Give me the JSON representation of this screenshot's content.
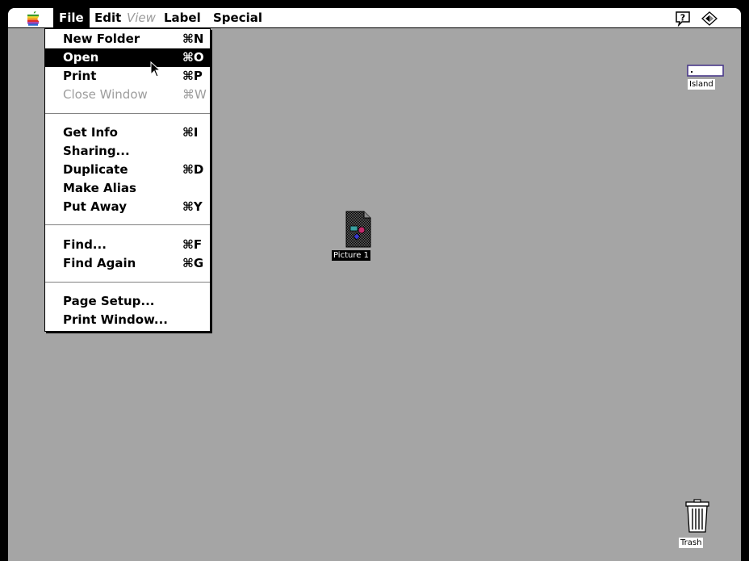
{
  "menubar": {
    "file": "File",
    "edit": "Edit",
    "view": "View",
    "label": "Label",
    "special": "Special",
    "apple_icon": "apple-icon",
    "help_icon": "balloon-help-icon",
    "app_icon": "finder-app-icon"
  },
  "file_menu": {
    "items": [
      {
        "label": "New Folder",
        "shortcut": "⌘N"
      },
      {
        "label": "Open",
        "shortcut": "⌘O",
        "selected": true
      },
      {
        "label": "Print",
        "shortcut": "⌘P"
      },
      {
        "label": "Close Window",
        "shortcut": "⌘W",
        "disabled": true
      },
      {
        "label": "Get Info",
        "shortcut": "⌘I"
      },
      {
        "label": "Sharing...",
        "shortcut": ""
      },
      {
        "label": "Duplicate",
        "shortcut": "⌘D"
      },
      {
        "label": "Make Alias",
        "shortcut": ""
      },
      {
        "label": "Put Away",
        "shortcut": "⌘Y"
      },
      {
        "label": "Find...",
        "shortcut": "⌘F"
      },
      {
        "label": "Find Again",
        "shortcut": "⌘G"
      },
      {
        "label": "Page Setup...",
        "shortcut": ""
      },
      {
        "label": "Print Window...",
        "shortcut": ""
      }
    ]
  },
  "desktop": {
    "picture_label": "Picture 1",
    "drive_label": "Island",
    "trash_label": "Trash"
  },
  "colors": {
    "desktop": "#a5a5a5",
    "highlight": "#000000",
    "disabled_text": "#9d9d9d"
  }
}
